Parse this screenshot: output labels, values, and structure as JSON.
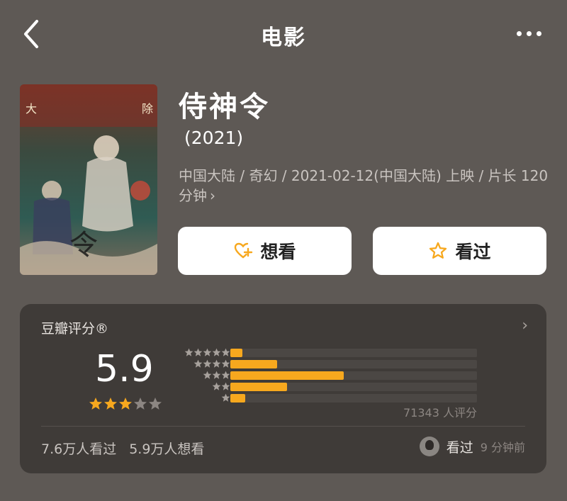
{
  "header": {
    "title": "电影",
    "back_icon": "chevron-left-icon",
    "more_icon": "more-dots-icon"
  },
  "movie": {
    "title": "侍神令",
    "year": "(2021)",
    "meta": "中国大陆 / 奇幻 / 2021-02-12(中国大陆) 上映 / 片长 120 分钟",
    "meta_chevron": "›"
  },
  "actions": {
    "want": {
      "label": "想看",
      "icon": "heart-plus-icon"
    },
    "seen": {
      "label": "看过",
      "icon": "star-outline-icon"
    }
  },
  "rating": {
    "label": "豆瓣评分®",
    "chevron": "›",
    "score": "5.9",
    "star_fill": 3,
    "star_total": 5,
    "distribution": [
      {
        "stars": 5,
        "fraction": 0.05
      },
      {
        "stars": 4,
        "fraction": 0.19
      },
      {
        "stars": 3,
        "fraction": 0.46
      },
      {
        "stars": 2,
        "fraction": 0.23
      },
      {
        "stars": 1,
        "fraction": 0.06
      }
    ],
    "count_text": "71343 人评分",
    "seen_count": "7.6万人看过",
    "want_count": "5.9万人想看",
    "activity_label": "看过",
    "activity_time": "9 分钟前"
  },
  "colors": {
    "accent": "#f7a81e",
    "background": "#5e5955",
    "card": "#3f3b38"
  }
}
